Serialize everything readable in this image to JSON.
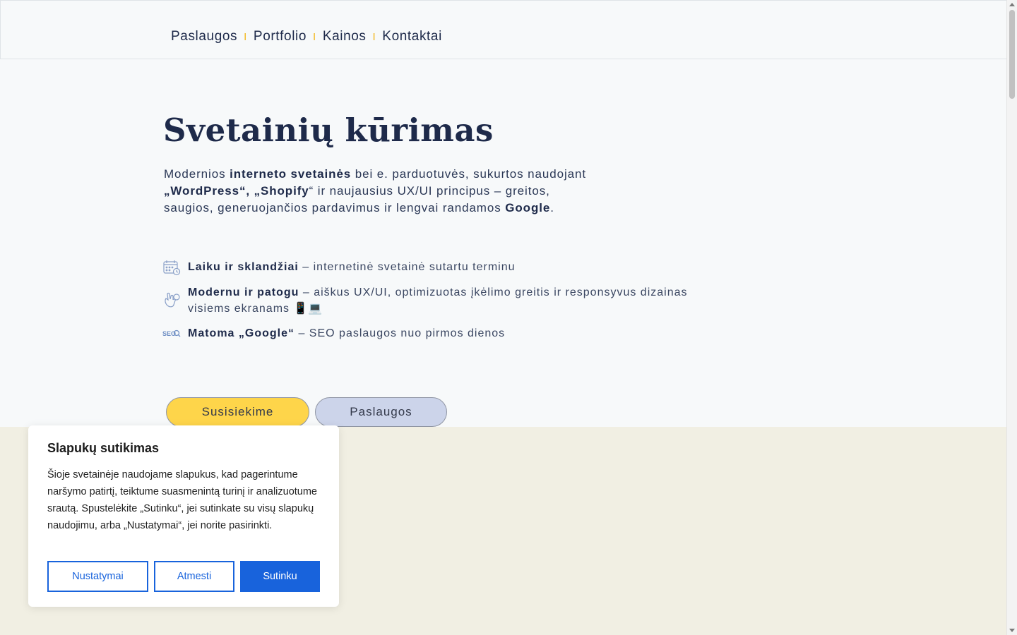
{
  "nav": {
    "items": [
      "Paslaugos",
      "Portfolio",
      "Kainos",
      "Kontaktai"
    ],
    "separator": "I"
  },
  "hero": {
    "title": "Svetainių kūrimas",
    "description": {
      "p1": "Modernios ",
      "b1": "interneto svetainės",
      "p2": " bei e. parduotuvės,  sukurtos naudojant ",
      "b2": "„WordPress“, „Shopify",
      "p3": "“ ir naujausius UX/UI principus – greitos, saugios, generuojančios pardavimus ir lengvai randamos ",
      "b3": "Google",
      "p4": "."
    }
  },
  "features": [
    {
      "icon": "calendar-icon",
      "bold": "Laiku ir sklandžiai",
      "text": " – internetinė svetainė sutartu terminu"
    },
    {
      "icon": "hand-pointer-icon",
      "bold": "Modernu ir patogu",
      "text": " – aiškus UX/UI, optimizuotas įkėlimo greitis ir responsyvus dizainas visiems ekranams 📱💻"
    },
    {
      "icon": "seo-search-icon",
      "bold": "Matoma „Google“",
      "text": " – SEO paslaugos nuo pirmos dienos"
    }
  ],
  "buttons": {
    "contact": "Susisiekime",
    "services": "Paslaugos"
  },
  "cookie": {
    "title": "Slapukų sutikimas",
    "text": "Šioje svetainėje naudojame slapukus, kad pagerintume naršymo patirtį, teiktume suasmenintą turinį ir analizuotume srautą. Spustelėkite „Sutinku“, jei sutinkate su visų slapukų naudojimu, arba „Nustatymai“, jei norite pasirinkti.",
    "settings_label": "Nustatymai",
    "reject_label": "Atmesti",
    "accept_label": "Sutinku"
  },
  "colors": {
    "accent_yellow": "#fed54a",
    "accent_blue_light": "#ccd4ea",
    "primary_blue": "#1863dc",
    "navy": "#1e2a4a",
    "beige": "#f1efe3"
  }
}
